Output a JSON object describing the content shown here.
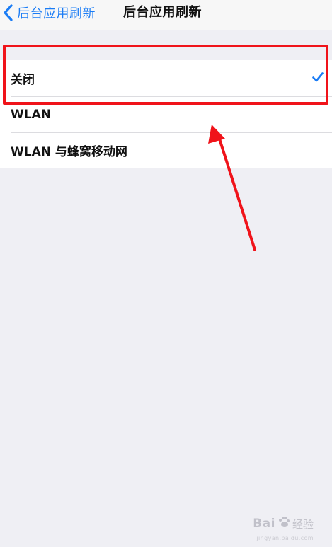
{
  "nav": {
    "back_label": "后台应用刷新",
    "title": "后台应用刷新"
  },
  "options": [
    {
      "label": "关闭",
      "selected": true
    },
    {
      "label": "WLAN",
      "selected": false
    },
    {
      "label": "WLAN 与蜂窝移动网",
      "selected": false
    }
  ],
  "colors": {
    "accent": "#1a7cf5",
    "annotation": "#f0131a",
    "background": "#efeff4"
  },
  "watermark": {
    "brand": "Bai",
    "suffix": "经验",
    "url": "jingyan.baidu.com"
  }
}
